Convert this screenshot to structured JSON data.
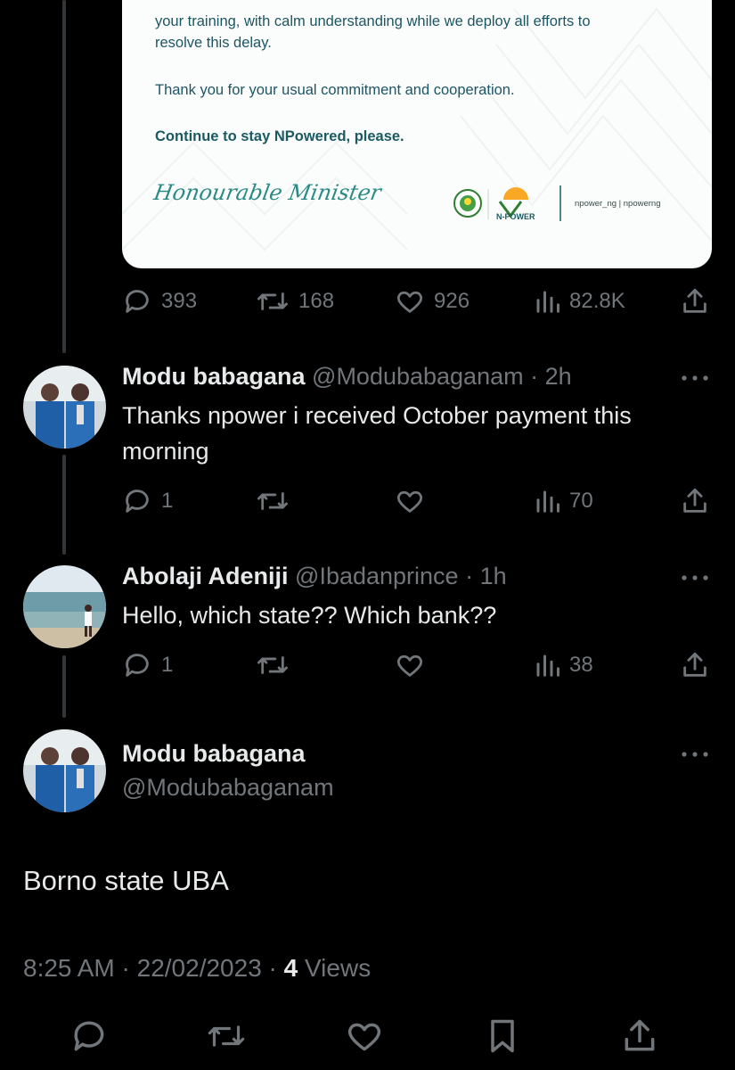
{
  "letter": {
    "paragraph_1_line_1": "your training, with calm understanding while we deploy all efforts to",
    "paragraph_1_line_2": "resolve this delay.",
    "paragraph_2": "Thank you for your usual commitment and cooperation.",
    "closing": "Continue to stay NPowered, please.",
    "signature": "Honourable Minister",
    "logo_text": "N-POWER",
    "handles": "npower_ng | npowerng"
  },
  "original_tweet": {
    "stats": {
      "replies": "393",
      "reposts": "168",
      "likes": "926",
      "views": "82.8K"
    }
  },
  "replies": [
    {
      "name": "Modu babagana",
      "handle": "@Modubabaganam",
      "time": "2h",
      "text": "Thanks npower i received October payment this morning",
      "stats": {
        "replies": "1",
        "reposts": "",
        "likes": "",
        "views": "70"
      }
    },
    {
      "name": "Abolaji Adeniji",
      "handle": "@Ibadanprince",
      "time": "1h",
      "text": "Hello, which state?? Which bank??",
      "stats": {
        "replies": "1",
        "reposts": "",
        "likes": "",
        "views": "38"
      }
    }
  ],
  "main_tweet": {
    "name": "Modu babagana",
    "handle": "@Modubabaganam",
    "text": "Borno state UBA",
    "time": "8:25 AM",
    "date": "22/02/2023",
    "views_count": "4",
    "views_label": "Views"
  },
  "colors": {
    "background": "#000000",
    "text": "#e7e9ea",
    "muted": "#71767b",
    "thread_line": "#333639",
    "letter_teal": "#1c5564"
  },
  "icons": [
    "reply-icon",
    "repost-icon",
    "like-icon",
    "views-icon",
    "share-icon",
    "more-icon",
    "bookmark-icon"
  ]
}
